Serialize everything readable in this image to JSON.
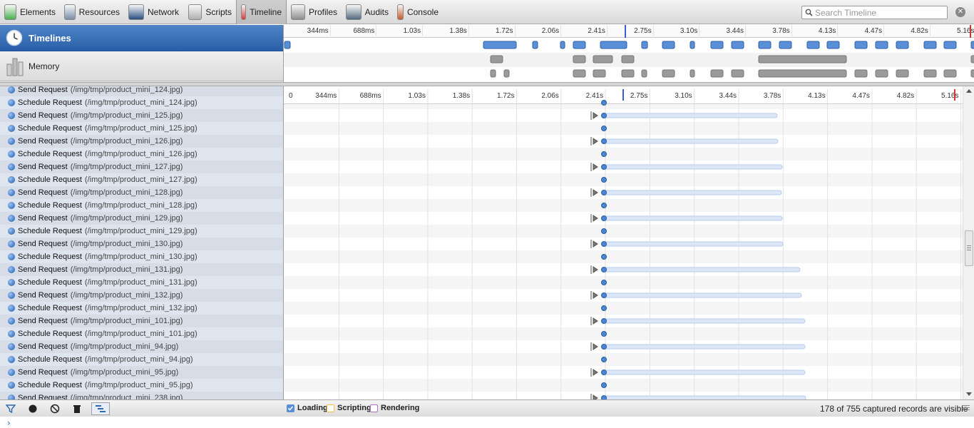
{
  "toolbar": {
    "tabs": [
      {
        "label": "Elements",
        "icon": "elements-icon",
        "color": "#4caf50"
      },
      {
        "label": "Resources",
        "icon": "resources-icon",
        "color": "#7a8ea8"
      },
      {
        "label": "Network",
        "icon": "network-icon",
        "color": "#2a4d80"
      },
      {
        "label": "Scripts",
        "icon": "scripts-icon",
        "color": "#b0b0b0"
      },
      {
        "label": "Timeline",
        "icon": "timeline-icon",
        "color": "#d43b3b"
      },
      {
        "label": "Profiles",
        "icon": "profiles-icon",
        "color": "#8d8d8d"
      },
      {
        "label": "Audits",
        "icon": "audits-icon",
        "color": "#556a80"
      },
      {
        "label": "Console",
        "icon": "console-icon",
        "color": "#c85a2a"
      }
    ],
    "active_tab": "Timeline",
    "search_placeholder": "Search Timeline"
  },
  "overview": {
    "timelines_label": "Timelines",
    "memory_label": "Memory",
    "ruler_ticks": [
      "344ms",
      "688ms",
      "1.03s",
      "1.38s",
      "1.72s",
      "2.06s",
      "2.41s",
      "2.75s",
      "3.10s",
      "3.44s",
      "3.78s",
      "4.13s",
      "4.47s",
      "4.82s",
      "5.16s"
    ]
  },
  "grid": {
    "ruler_ticks": [
      "0",
      "344ms",
      "688ms",
      "1.03s",
      "1.38s",
      "1.72s",
      "2.06s",
      "2.41s",
      "2.75s",
      "3.10s",
      "3.44s",
      "3.78s",
      "4.13s",
      "4.47s",
      "4.82s",
      "5.16s"
    ]
  },
  "records": [
    {
      "type": "Send Request",
      "detail": "(/img/tmp/product_mini_124.jpg)"
    },
    {
      "type": "Schedule Request",
      "detail": "(/img/tmp/product_mini_124.jpg)"
    },
    {
      "type": "Send Request",
      "detail": "(/img/tmp/product_mini_125.jpg)"
    },
    {
      "type": "Schedule Request",
      "detail": "(/img/tmp/product_mini_125.jpg)"
    },
    {
      "type": "Send Request",
      "detail": "(/img/tmp/product_mini_126.jpg)"
    },
    {
      "type": "Schedule Request",
      "detail": "(/img/tmp/product_mini_126.jpg)"
    },
    {
      "type": "Send Request",
      "detail": "(/img/tmp/product_mini_127.jpg)"
    },
    {
      "type": "Schedule Request",
      "detail": "(/img/tmp/product_mini_127.jpg)"
    },
    {
      "type": "Send Request",
      "detail": "(/img/tmp/product_mini_128.jpg)"
    },
    {
      "type": "Schedule Request",
      "detail": "(/img/tmp/product_mini_128.jpg)"
    },
    {
      "type": "Send Request",
      "detail": "(/img/tmp/product_mini_129.jpg)"
    },
    {
      "type": "Schedule Request",
      "detail": "(/img/tmp/product_mini_129.jpg)"
    },
    {
      "type": "Send Request",
      "detail": "(/img/tmp/product_mini_130.jpg)"
    },
    {
      "type": "Schedule Request",
      "detail": "(/img/tmp/product_mini_130.jpg)"
    },
    {
      "type": "Send Request",
      "detail": "(/img/tmp/product_mini_131.jpg)"
    },
    {
      "type": "Schedule Request",
      "detail": "(/img/tmp/product_mini_131.jpg)"
    },
    {
      "type": "Send Request",
      "detail": "(/img/tmp/product_mini_132.jpg)"
    },
    {
      "type": "Schedule Request",
      "detail": "(/img/tmp/product_mini_132.jpg)"
    },
    {
      "type": "Send Request",
      "detail": "(/img/tmp/product_mini_101.jpg)"
    },
    {
      "type": "Schedule Request",
      "detail": "(/img/tmp/product_mini_101.jpg)"
    },
    {
      "type": "Send Request",
      "detail": "(/img/tmp/product_mini_94.jpg)"
    },
    {
      "type": "Schedule Request",
      "detail": "(/img/tmp/product_mini_94.jpg)"
    },
    {
      "type": "Send Request",
      "detail": "(/img/tmp/product_mini_95.jpg)"
    },
    {
      "type": "Schedule Request",
      "detail": "(/img/tmp/product_mini_95.jpg)"
    },
    {
      "type": "Send Request",
      "detail": "(/img/tmp/product_mini_238.jpg)"
    }
  ],
  "status": {
    "categories": [
      {
        "label": "Loading",
        "checked": true,
        "color": "#5a8fd8"
      },
      {
        "label": "Scripting",
        "checked": false,
        "color": "#f0c040"
      },
      {
        "label": "Rendering",
        "checked": false,
        "color": "#b070c8"
      }
    ],
    "records_count": "178 of 755 captured records are visible"
  },
  "colors": {
    "accent": "#2f67b0",
    "loading_bar": "#5a8fd8",
    "memory_bar": "#9a9a9a"
  }
}
